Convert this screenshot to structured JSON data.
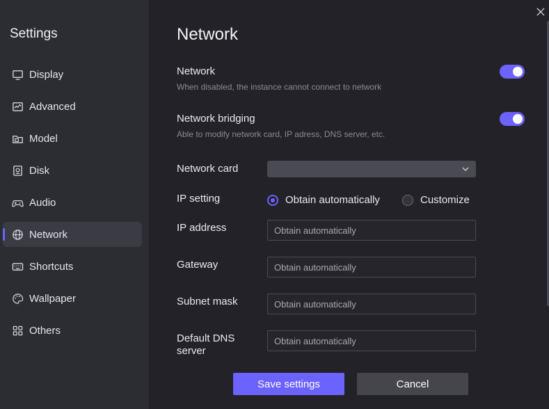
{
  "sidebar": {
    "title": "Settings",
    "active": "Network",
    "items": [
      {
        "label": "Display",
        "icon": "monitor-icon"
      },
      {
        "label": "Advanced",
        "icon": "chart-icon"
      },
      {
        "label": "Model",
        "icon": "folder-icon"
      },
      {
        "label": "Disk",
        "icon": "disk-icon"
      },
      {
        "label": "Audio",
        "icon": "gamepad-icon"
      },
      {
        "label": "Network",
        "icon": "globe-icon"
      },
      {
        "label": "Shortcuts",
        "icon": "keyboard-icon"
      },
      {
        "label": "Wallpaper",
        "icon": "palette-icon"
      },
      {
        "label": "Others",
        "icon": "grid-icon"
      }
    ]
  },
  "page": {
    "title": "Network",
    "network": {
      "title": "Network",
      "desc": "When disabled, the instance cannot connect to network",
      "enabled": true
    },
    "bridging": {
      "title": "Network bridging",
      "desc": "Able to modify network card, IP adress, DNS server, etc.",
      "enabled": true
    },
    "network_card": {
      "label": "Network card",
      "value": ""
    },
    "ip_setting": {
      "label": "IP setting",
      "options": [
        "Obtain automatically",
        "Customize"
      ],
      "selected": "Obtain automatically"
    },
    "ip_address": {
      "label": "IP address",
      "placeholder": "Obtain automatically"
    },
    "gateway": {
      "label": "Gateway",
      "placeholder": "Obtain automatically"
    },
    "subnet_mask": {
      "label": "Subnet mask",
      "placeholder": "Obtain automatically"
    },
    "dns": {
      "label_line1": "Default DNS",
      "label_line2": "server",
      "placeholder": "Obtain automatically"
    }
  },
  "actions": {
    "save": "Save settings",
    "cancel": "Cancel"
  },
  "colors": {
    "accent": "#6c63ff",
    "sidebar_bg": "#2c2c33",
    "main_bg": "#222228"
  }
}
